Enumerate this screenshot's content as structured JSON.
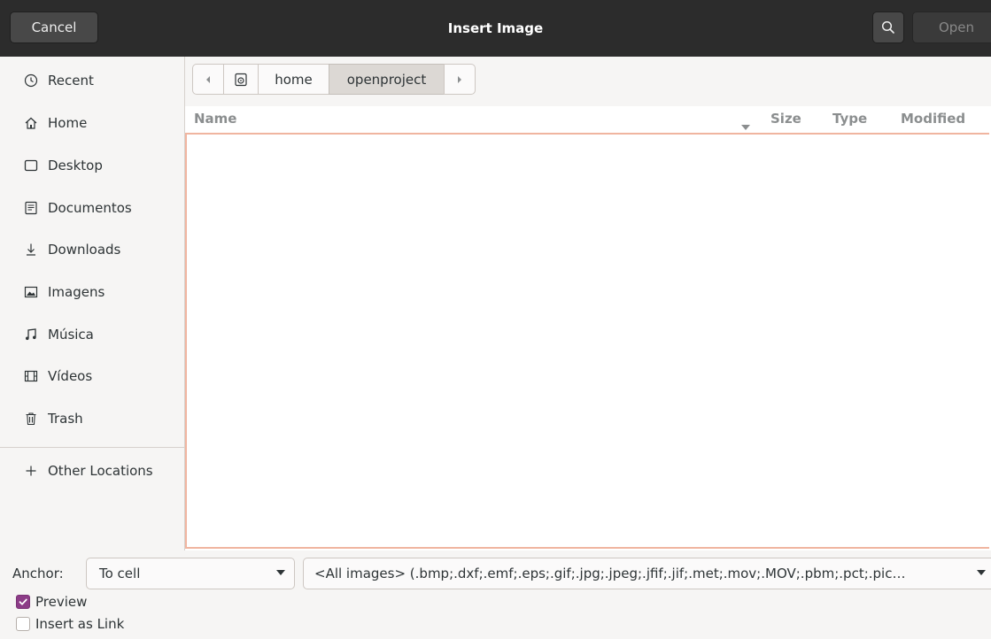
{
  "header": {
    "cancel_label": "Cancel",
    "title": "Insert Image",
    "open_label": "Open",
    "search_icon": "search-icon"
  },
  "sidebar": {
    "items": [
      {
        "label": "Recent",
        "icon": "clock-icon"
      },
      {
        "label": "Home",
        "icon": "home-icon"
      },
      {
        "label": "Desktop",
        "icon": "desktop-icon"
      },
      {
        "label": "Documentos",
        "icon": "document-icon"
      },
      {
        "label": "Downloads",
        "icon": "download-icon"
      },
      {
        "label": "Imagens",
        "icon": "image-icon"
      },
      {
        "label": "Música",
        "icon": "music-icon"
      },
      {
        "label": "Vídeos",
        "icon": "video-icon"
      },
      {
        "label": "Trash",
        "icon": "trash-icon"
      }
    ],
    "other_locations": {
      "label": "Other Locations",
      "icon": "plus-icon"
    }
  },
  "pathbar": {
    "segments": [
      "home",
      "openproject"
    ],
    "active_segment": "openproject"
  },
  "columns": {
    "name": "Name",
    "size": "Size",
    "type": "Type",
    "modified": "Modified"
  },
  "bottom": {
    "anchor_label": "Anchor:",
    "anchor_value": "To cell",
    "filter_value": "<All images> (.bmp;.dxf;.emf;.eps;.gif;.jpg;.jpeg;.jfif;.jif;.met;.mov;.MOV;.pbm;.pct;.pic…",
    "preview_label": "Preview",
    "preview_checked": true,
    "insert_link_label": "Insert as Link",
    "insert_link_checked": false
  },
  "colors": {
    "accent_checkbox": "#8c3c87",
    "focus_border": "#f0b5a0",
    "headerbar": "#2c2c2c"
  }
}
